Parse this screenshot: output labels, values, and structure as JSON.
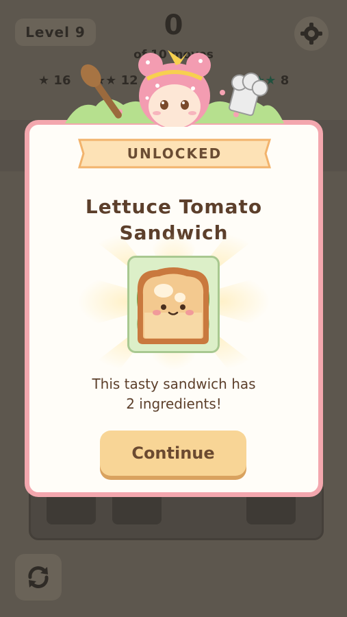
{
  "hud": {
    "level_label": "Level 9",
    "moves_count": "0",
    "moves_label": "of 10 moves",
    "star_goals": [
      {
        "stars": "★",
        "count": "16"
      },
      {
        "stars": "★★",
        "count": "12"
      },
      {
        "stars": "★★★",
        "count": "8"
      }
    ]
  },
  "modal": {
    "banner": "UNLOCKED",
    "title_line1": "Lettuce Tomato",
    "title_line2": "Sandwich",
    "description_line1": "This tasty sandwich has",
    "description_line2": "2 ingredients!",
    "continue_label": "Continue",
    "dish_icon": "sandwich-icon"
  },
  "colors": {
    "frame_pink": "#f3a7ae",
    "button_fill": "#f8d596",
    "banner_fill": "#fde2b6",
    "title_brown": "#5c3f2b"
  }
}
